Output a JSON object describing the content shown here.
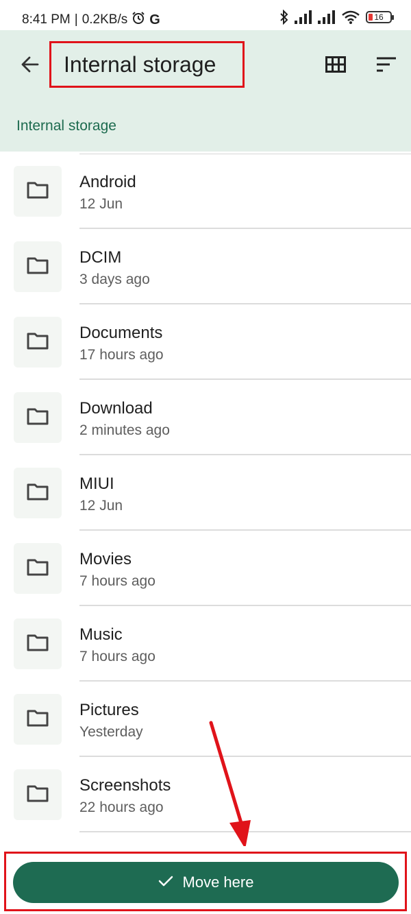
{
  "status_bar": {
    "time": "8:41 PM",
    "speed": "0.2KB/s",
    "battery": "16",
    "icons": [
      "alarm-icon",
      "google-icon",
      "bluetooth-icon",
      "signal-icon",
      "signal-icon",
      "wifi-icon",
      "battery-icon"
    ]
  },
  "app_bar": {
    "title": "Internal storage",
    "breadcrumb": "Internal storage",
    "back_icon": "arrow-back-icon",
    "grid_icon": "grid-view-icon",
    "sort_icon": "sort-icon"
  },
  "folders": [
    {
      "name": "Android",
      "date": "12 Jun"
    },
    {
      "name": "DCIM",
      "date": "3 days ago"
    },
    {
      "name": "Documents",
      "date": "17 hours ago"
    },
    {
      "name": "Download",
      "date": "2 minutes ago"
    },
    {
      "name": "MIUI",
      "date": "12 Jun"
    },
    {
      "name": "Movies",
      "date": "7 hours ago"
    },
    {
      "name": "Music",
      "date": "7 hours ago"
    },
    {
      "name": "Pictures",
      "date": "Yesterday"
    },
    {
      "name": "Screenshots",
      "date": "22 hours ago"
    }
  ],
  "action": {
    "label": "Move here",
    "icon": "check-icon"
  },
  "colors": {
    "accent": "#1e6b52",
    "app_bar_bg": "#e2efe8",
    "annotation": "#e0131a"
  }
}
